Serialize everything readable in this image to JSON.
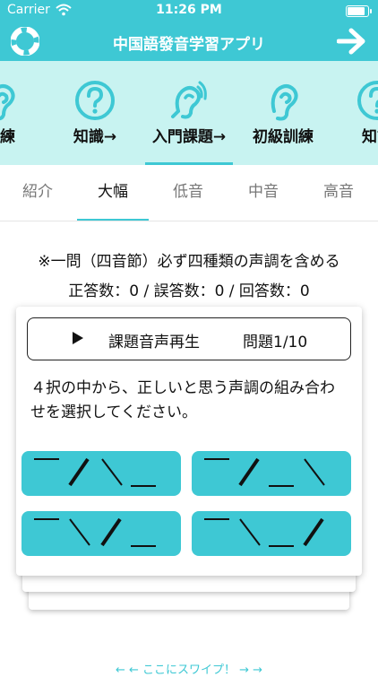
{
  "status": {
    "carrier": "Carrier",
    "time": "11:26 PM",
    "battery_level": 0.95
  },
  "nav": {
    "title": "中国語發音学習アプリ",
    "left_icon": "lifebuoy-icon",
    "right_icon": "arrow-right-icon"
  },
  "icon_tabs": [
    {
      "label": "訓練",
      "icon": "ear-icon"
    },
    {
      "label": "知識→",
      "icon": "question-icon"
    },
    {
      "label": "入門課題→",
      "icon": "hearing-icon",
      "active": true
    },
    {
      "label": "初級訓練",
      "icon": "ear-icon"
    },
    {
      "label": "知識",
      "icon": "question-icon"
    }
  ],
  "tabs": [
    "紹介",
    "大幅",
    "低音",
    "中音",
    "高音"
  ],
  "active_tab": "大幅",
  "note": "※一問（四音節）必ず四種類の声調を含める",
  "score": "正答数：0 / 誤答数：0 / 回答数：0",
  "card": {
    "play_label": "課題音声再生",
    "question": "問題1/10",
    "instruction": "４択の中から、正しいと思う声調の組み合わせを選択してください。",
    "options": [
      {
        "tones": [
          1,
          2,
          4,
          5
        ]
      },
      {
        "tones": [
          1,
          2,
          5,
          4
        ]
      },
      {
        "tones": [
          1,
          4,
          2,
          5
        ]
      },
      {
        "tones": [
          1,
          4,
          5,
          2
        ]
      }
    ]
  },
  "swipe_hint": "←  ←  ここにスワイプ！ →  →",
  "colors": {
    "accent": "#3ec8d4",
    "iconbar_bg": "#c8f3f1"
  }
}
